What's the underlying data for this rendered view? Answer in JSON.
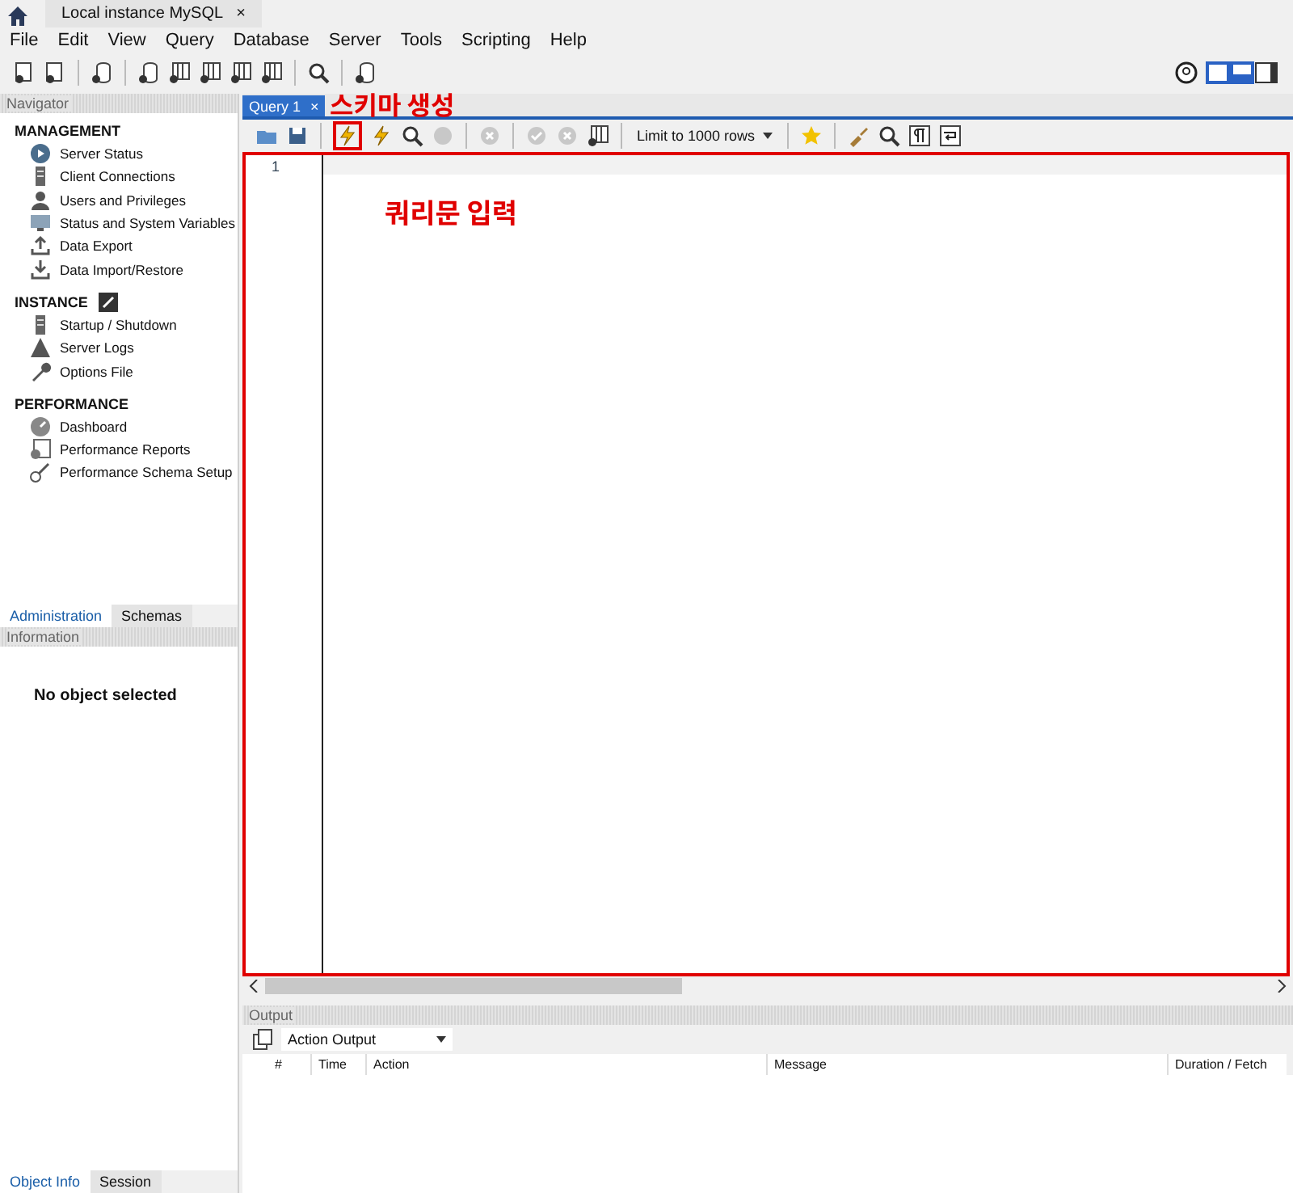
{
  "app_tabs": [
    {
      "label": "Local instance MySQL",
      "close": "×",
      "selected": true
    }
  ],
  "menu": [
    "File",
    "Edit",
    "View",
    "Query",
    "Database",
    "Server",
    "Tools",
    "Scripting",
    "Help"
  ],
  "navigator": {
    "title": "Navigator",
    "sections": [
      {
        "title": "MANAGEMENT",
        "items": [
          "Server Status",
          "Client Connections",
          "Users and Privileges",
          "Status and System Variables",
          "Data Export",
          "Data Import/Restore"
        ]
      },
      {
        "title": "INSTANCE",
        "items": [
          "Startup / Shutdown",
          "Server Logs",
          "Options File"
        ]
      },
      {
        "title": "PERFORMANCE",
        "items": [
          "Dashboard",
          "Performance Reports",
          "Performance Schema Setup"
        ]
      }
    ]
  },
  "sidebar_tabs": [
    {
      "label": "Administration",
      "selected": true
    },
    {
      "label": "Schemas",
      "selected": false
    }
  ],
  "information": {
    "title": "Information",
    "message": "No object selected"
  },
  "bottom_tabs": [
    {
      "label": "Object Info",
      "selected": true
    },
    {
      "label": "Session",
      "selected": false
    }
  ],
  "query_tabs": [
    {
      "label": "Query 1",
      "close": "×",
      "selected": true
    }
  ],
  "query_toolbar": {
    "limit": "Limit to 1000 rows",
    "execute_highlighted": true
  },
  "editor": {
    "line_numbers": [
      "1"
    ],
    "highlighted": true
  },
  "annotations": [
    {
      "kind": "toolbar",
      "text": "스키마 생성"
    },
    {
      "kind": "editor",
      "text": "쿼리문 입력"
    }
  ],
  "output": {
    "title": "Output",
    "selector": "Action Output",
    "columns": [
      "#",
      "Time",
      "Action",
      "Message",
      "Duration / Fetch"
    ]
  }
}
